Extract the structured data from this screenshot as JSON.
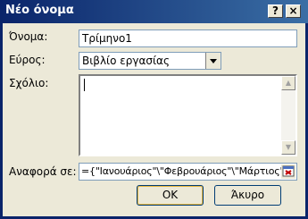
{
  "dialog": {
    "title": "Νέο όνομα",
    "help_button": "?",
    "close_button": "×"
  },
  "fields": {
    "name_label": "Όνομα:",
    "name_value": "Τρίμηνο1",
    "scope_label": "Εύρος:",
    "scope_value": "Βιβλίο εργασίας",
    "comment_label": "Σχόλιο:",
    "comment_value": "",
    "refers_to_label": "Αναφορά σε:",
    "refers_to_value": "={\"Ιανουάριος\"\\\"Φεβρουάριος\"\\\"Μάρτιος\"}"
  },
  "buttons": {
    "ok": "OK",
    "cancel": "Άκυρο"
  },
  "icons": {
    "scope_dropdown": "chevron-down-icon",
    "scroll_up": "scroll-up-icon",
    "scroll_down": "scroll-down-icon",
    "collapse_dialog": "collapse-dialog-icon"
  }
}
